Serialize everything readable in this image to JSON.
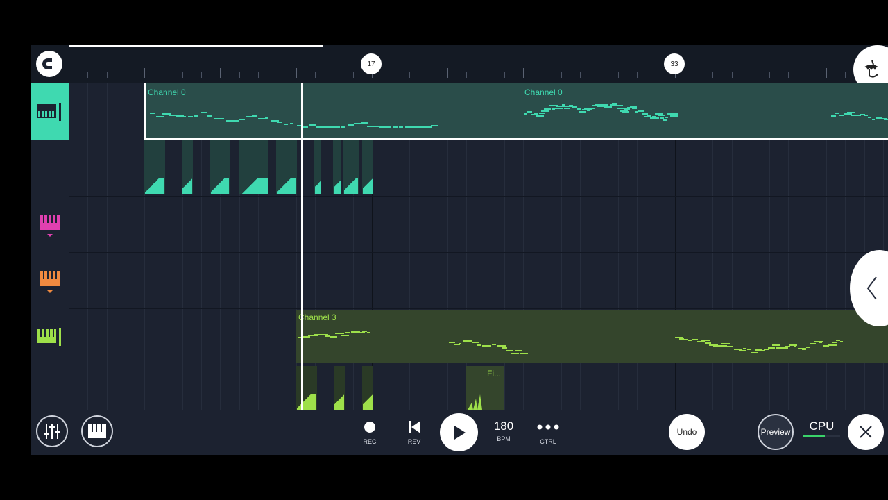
{
  "timeline": {
    "bar_markers": [
      "17",
      "33"
    ]
  },
  "tracks": {
    "clip_channel0_a": "Channel 0",
    "clip_channel0_b": "Channel 0",
    "clip_channel3": "Channel 3",
    "clip_fi": "Fi..."
  },
  "transport": {
    "rec_label": "REC",
    "rev_label": "REV",
    "tempo_value": "180",
    "tempo_label": "BPM",
    "ctrl_label": "CTRL",
    "undo_label": "Undo",
    "preview_label": "Preview",
    "cpu_label": "CPU"
  },
  "icons": {
    "magnet": "magnet-icon",
    "logo": "fl-fruit-logo-icon",
    "mixer": "mixer-icon",
    "piano": "piano-icon",
    "record": "record-icon",
    "rewind": "rewind-icon",
    "play": "play-icon",
    "more": "more-icon",
    "close": "close-icon",
    "chevron": "chevron-left-icon"
  },
  "colors": {
    "teal": "#3fd9b0",
    "magenta": "#e040b0",
    "orange": "#f08a40",
    "lime": "#9ee04a",
    "background": "#1c2230"
  }
}
